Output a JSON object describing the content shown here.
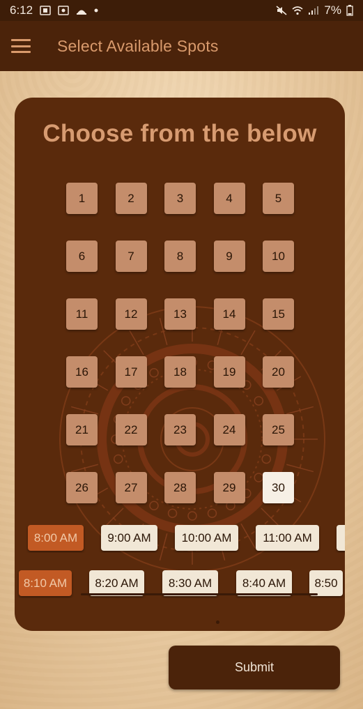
{
  "status_bar": {
    "time": "6:12",
    "battery": "7%"
  },
  "app_bar": {
    "title": "Select Available Spots"
  },
  "card": {
    "heading": "Choose from the below",
    "spots": [
      "1",
      "2",
      "3",
      "4",
      "5",
      "6",
      "7",
      "8",
      "9",
      "10",
      "11",
      "12",
      "13",
      "14",
      "15",
      "16",
      "17",
      "18",
      "19",
      "20",
      "21",
      "22",
      "23",
      "24",
      "25",
      "26",
      "27",
      "28",
      "29",
      "30"
    ],
    "selected_spot": "30",
    "times_row1": [
      "8:00 AM",
      "9:00 AM",
      "10:00 AM",
      "11:00 AM",
      ""
    ],
    "times_row2": [
      "8:10 AM",
      "8:20 AM",
      "8:30 AM",
      "8:40 AM",
      "8:50"
    ],
    "active_time_row1": "8:00 AM",
    "active_time_row2": "8:10 AM"
  },
  "submit": {
    "label": "Submit"
  },
  "colors": {
    "app_bar": "#4b230a",
    "card": "#5a2a0c",
    "spot": "#c48d6b",
    "spot_selected": "#f7f0e6",
    "time_active": "#c25a24",
    "accent_text": "#d79b71"
  },
  "icons": {
    "menu": "hamburger-menu-icon",
    "status_left": [
      "screenshot-icon",
      "screen-record-icon",
      "weather-icon",
      "notification-dot-icon"
    ],
    "status_right": [
      "mute-icon",
      "wifi-icon",
      "signal-icon",
      "battery-icon"
    ]
  }
}
